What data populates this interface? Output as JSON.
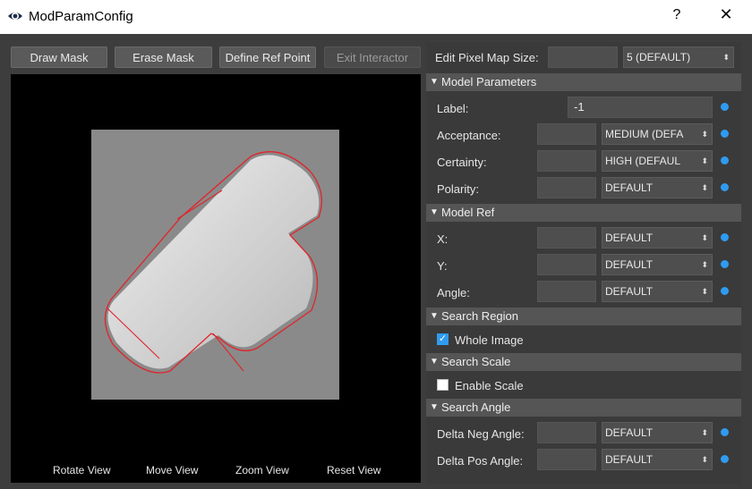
{
  "window": {
    "title": "ModParamConfig",
    "help_label": "?",
    "close_label": "✕"
  },
  "toolbar": {
    "draw_mask": "Draw Mask",
    "erase_mask": "Erase Mask",
    "define_ref_point": "Define Ref Point",
    "exit_interactor": "Exit Interactor"
  },
  "viewer": {
    "rotate_view": "Rotate View",
    "move_view": "Move View",
    "zoom_view": "Zoom View",
    "reset_view": "Reset View"
  },
  "pixel_map": {
    "label": "Edit Pixel Map Size:",
    "value": "",
    "selected": "5 (DEFAULT)"
  },
  "model_parameters": {
    "header": "Model Parameters",
    "label_label": "Label:",
    "label_value": "-1",
    "acceptance_label": "Acceptance:",
    "acceptance_selected": "MEDIUM (DEFA",
    "certainty_label": "Certainty:",
    "certainty_selected": "HIGH (DEFAUL",
    "polarity_label": "Polarity:",
    "polarity_selected": "DEFAULT"
  },
  "model_ref": {
    "header": "Model Ref",
    "x_label": "X:",
    "x_selected": "DEFAULT",
    "y_label": "Y:",
    "y_selected": "DEFAULT",
    "angle_label": "Angle:",
    "angle_selected": "DEFAULT"
  },
  "search_region": {
    "header": "Search Region",
    "whole_image_label": "Whole Image",
    "whole_image_checked": true
  },
  "search_scale": {
    "header": "Search Scale",
    "enable_scale_label": "Enable Scale",
    "enable_scale_checked": false
  },
  "search_angle": {
    "header": "Search Angle",
    "delta_neg_label": "Delta Neg Angle:",
    "delta_neg_selected": "DEFAULT",
    "delta_pos_label": "Delta Pos Angle:",
    "delta_pos_selected": "DEFAULT"
  },
  "colors": {
    "accent": "#2f9bf0",
    "contour": "#e0242a"
  }
}
